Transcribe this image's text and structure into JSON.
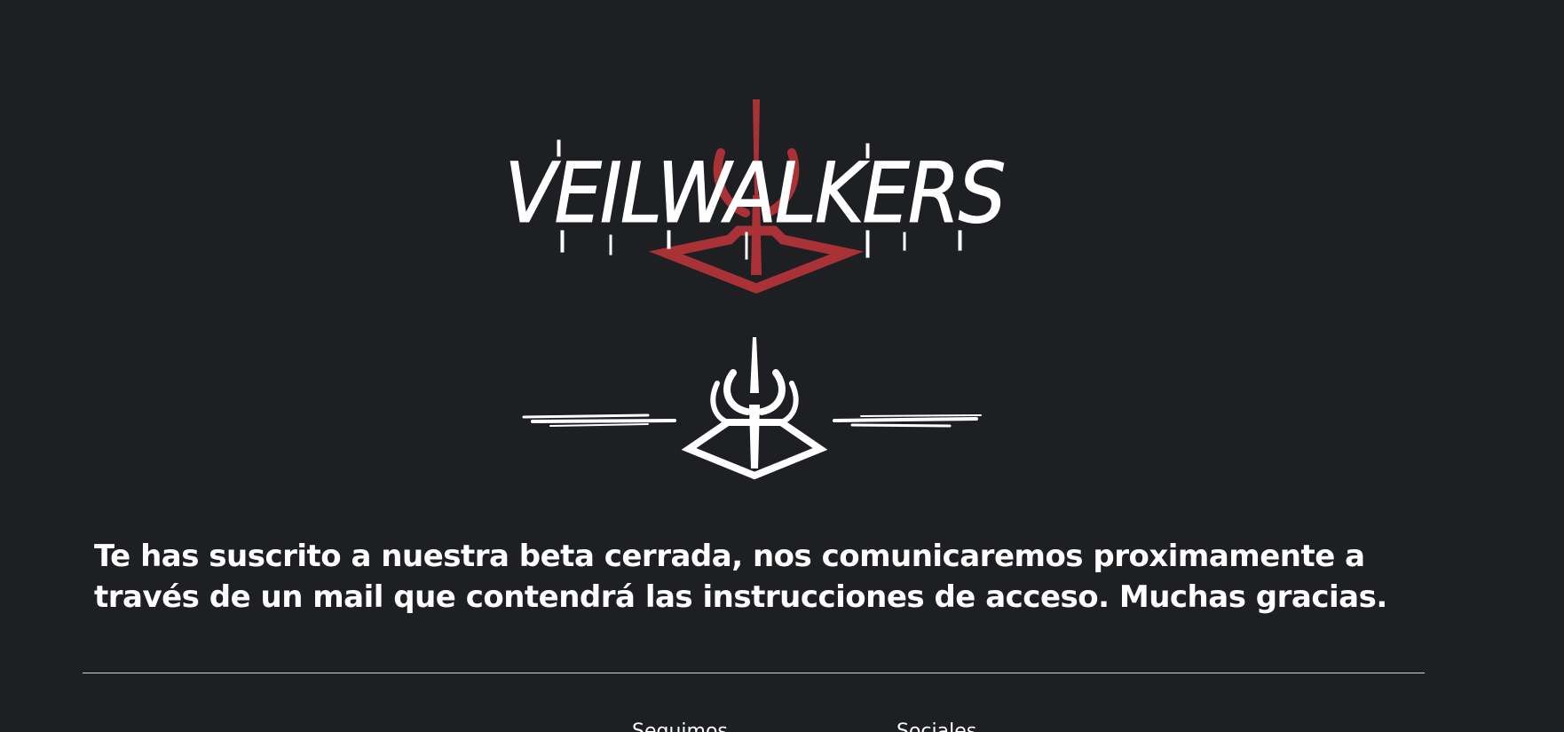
{
  "brand": {
    "logo_text": "VEILWALKERS",
    "accent_color": "#a83236",
    "background_color": "#1d1f22"
  },
  "main": {
    "message": "Te has suscrito a nuestra beta cerrada, nos comunicaremos proximamente a través de un mail que contendrá las instrucciones de acceso. Muchas gracias."
  },
  "footer": {
    "links": [
      {
        "label": "Seguimos"
      },
      {
        "label": "Sociales"
      }
    ]
  }
}
